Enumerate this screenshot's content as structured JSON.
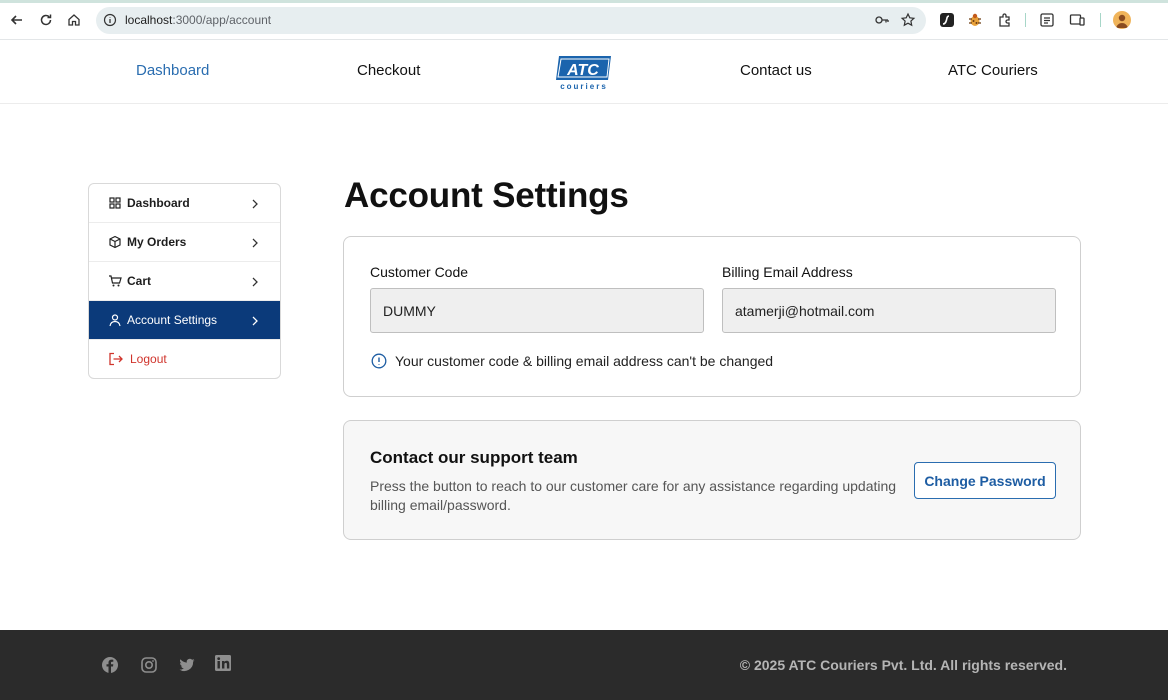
{
  "browser": {
    "url_host": "localhost",
    "url_rest": ":3000/app/account"
  },
  "header": {
    "nav": [
      "Dashboard",
      "Checkout",
      "Contact us",
      "ATC Couriers"
    ],
    "active": "Dashboard",
    "logo_text": "ATC",
    "logo_subtext": "couriers",
    "brand_color": "#1b64ad"
  },
  "sidebar": {
    "items": [
      {
        "label": "Dashboard",
        "icon": "grid-icon"
      },
      {
        "label": "My Orders",
        "icon": "box-icon"
      },
      {
        "label": "Cart",
        "icon": "cart-icon"
      },
      {
        "label": "Account Settings",
        "icon": "user-icon",
        "active": true
      },
      {
        "label": "Logout",
        "icon": "logout-icon"
      }
    ],
    "active_color": "#0b3a7a"
  },
  "main": {
    "title": "Account Settings",
    "customer_code": {
      "label": "Customer Code",
      "value": "DUMMY"
    },
    "billing_email": {
      "label": "Billing Email Address",
      "value": "atamerji@hotmail.com"
    },
    "note": "Your customer code & billing email address can't be changed",
    "support": {
      "heading": "Contact our support team",
      "text": "Press the button to reach to our customer care for any assistance regarding updating billing email/password.",
      "button": "Change Password"
    }
  },
  "footer": {
    "social": [
      "facebook-icon",
      "instagram-icon",
      "twitter-icon",
      "linkedin-icon"
    ],
    "copyright": "© 2025 ATC Couriers Pvt. Ltd. All rights reserved."
  }
}
